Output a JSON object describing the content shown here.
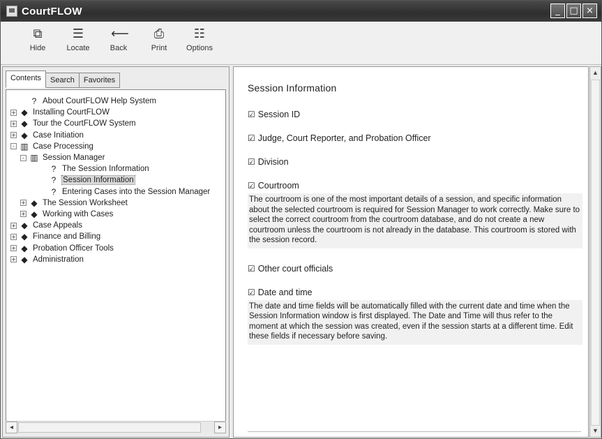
{
  "window": {
    "title": "CourtFLOW",
    "controls": [
      "_",
      "□",
      "×"
    ]
  },
  "toolbar": {
    "buttons": [
      {
        "label": "Hide",
        "icon": "hide-icon",
        "glyph": "⧉"
      },
      {
        "label": "Locate",
        "icon": "locate-icon",
        "glyph": "☰"
      },
      {
        "label": "Back",
        "icon": "back-icon",
        "glyph": "⟵"
      },
      {
        "label": "Print",
        "icon": "print-icon",
        "glyph": "⎙"
      },
      {
        "label": "Options",
        "icon": "options-icon",
        "glyph": "☷"
      }
    ]
  },
  "left": {
    "tabs": [
      "Contents",
      "Search",
      "Favorites"
    ],
    "active_tab": 0,
    "tree": [
      {
        "indent": 1,
        "exp": "",
        "icon": "?",
        "label": "About CourtFLOW Help System"
      },
      {
        "indent": 0,
        "exp": "+",
        "icon": "◆",
        "label": "Installing CourtFLOW"
      },
      {
        "indent": 0,
        "exp": "+",
        "icon": "◆",
        "label": "Tour the CourtFLOW System"
      },
      {
        "indent": 0,
        "exp": "+",
        "icon": "◆",
        "label": "Case Initiation"
      },
      {
        "indent": 0,
        "exp": "-",
        "icon": "▥",
        "label": "Case Processing"
      },
      {
        "indent": 1,
        "exp": "-",
        "icon": "▥",
        "label": "Session Manager"
      },
      {
        "indent": 3,
        "exp": "",
        "icon": "?",
        "label": "The Session Information"
      },
      {
        "indent": 3,
        "exp": "",
        "icon": "?",
        "label": "Session Information",
        "selected": true
      },
      {
        "indent": 3,
        "exp": "",
        "icon": "?",
        "label": "Entering Cases into the Session Manager"
      },
      {
        "indent": 1,
        "exp": "+",
        "icon": "◆",
        "label": "The Session Worksheet"
      },
      {
        "indent": 1,
        "exp": "+",
        "icon": "◆",
        "label": "Working with Cases"
      },
      {
        "indent": 0,
        "exp": "+",
        "icon": "◆",
        "label": "Case Appeals"
      },
      {
        "indent": 0,
        "exp": "+",
        "icon": "◆",
        "label": "Finance and Billing"
      },
      {
        "indent": 0,
        "exp": "+",
        "icon": "◆",
        "label": "Probation Officer Tools"
      },
      {
        "indent": 0,
        "exp": "+",
        "icon": "◆",
        "label": "Administration"
      }
    ]
  },
  "right": {
    "title": "Session Information",
    "sections": [
      {
        "label": "Session ID",
        "para": ""
      },
      {
        "label": "Judge, Court Reporter, and Probation Officer",
        "para": ""
      },
      {
        "label": "Division",
        "para": ""
      },
      {
        "label": "Courtroom",
        "para": "The courtroom is one of the most important details of a session, and specific information about the selected courtroom is required for Session Manager to work correctly. Make sure to select the correct courtroom from the courtroom database, and do not create a new courtroom unless the courtroom is not already in the database. This courtroom is stored with the session record."
      },
      {
        "label": "Other court officials",
        "para": ""
      },
      {
        "label": "Date and time",
        "para": "The date and time fields will be automatically filled with the current date and time when the Session Information window is first displayed. The Date and Time will thus refer to the moment at which the session was created, even if the session starts at a different time. Edit these fields if necessary before saving."
      }
    ]
  }
}
